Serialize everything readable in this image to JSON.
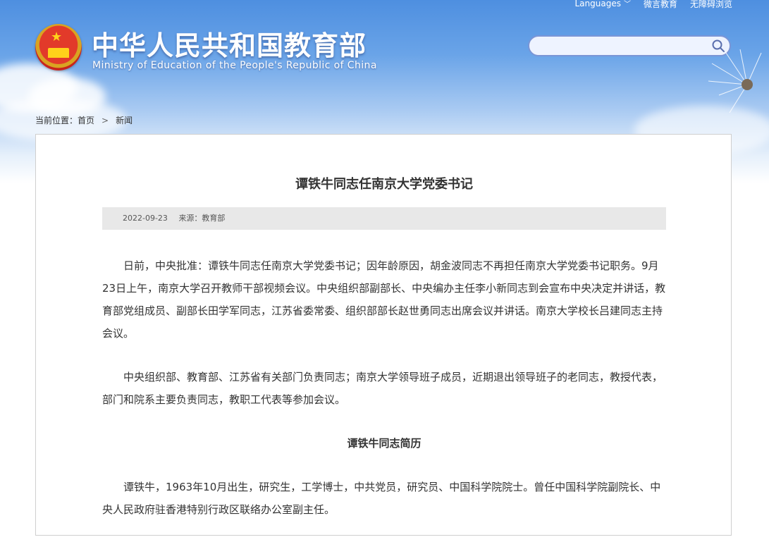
{
  "header": {
    "title": "中华人民共和国教育部",
    "subtitle": "Ministry of Education of the People's Republic of China",
    "nav": {
      "languages": "Languages",
      "weiyan": "微言教育",
      "accessibility": "无障碍浏览"
    },
    "search": {
      "placeholder": ""
    }
  },
  "breadcrumb": {
    "prefix": "当前位置：",
    "home": "首页",
    "separator": ">",
    "current": "新闻"
  },
  "article": {
    "title": "谭铁牛同志任南京大学党委书记",
    "date": "2022-09-23",
    "source": "来源：教育部",
    "paragraphs": [
      "日前，中央批准：谭铁牛同志任南京大学党委书记；因年龄原因，胡金波同志不再担任南京大学党委书记职务。9月23日上午，南京大学召开教师干部视频会议。中央组织部副部长、中央编办主任李小新同志到会宣布中央决定并讲话，教育部党组成员、副部长田学军同志，江苏省委常委、组织部部长赵世勇同志出席会议并讲话。南京大学校长吕建同志主持会议。",
      "中央组织部、教育部、江苏省有关部门负责同志；南京大学领导班子成员，近期退出领导班子的老同志，教授代表，部门和院系主要负责同志，教职工代表等参加会议。"
    ],
    "subheading": "谭铁牛同志简历",
    "bio": "谭铁牛，1963年10月出生，研究生，工学博士，中共党员，研究员、中国科学院院士。曾任中国科学院副院长、中央人民政府驻香港特别行政区联络办公室副主任。"
  },
  "colors": {
    "banner_top": "#4e8fe0",
    "title_text": "#333333",
    "meta_bg": "#e8e8e8",
    "search_border": "#7a95d6"
  }
}
